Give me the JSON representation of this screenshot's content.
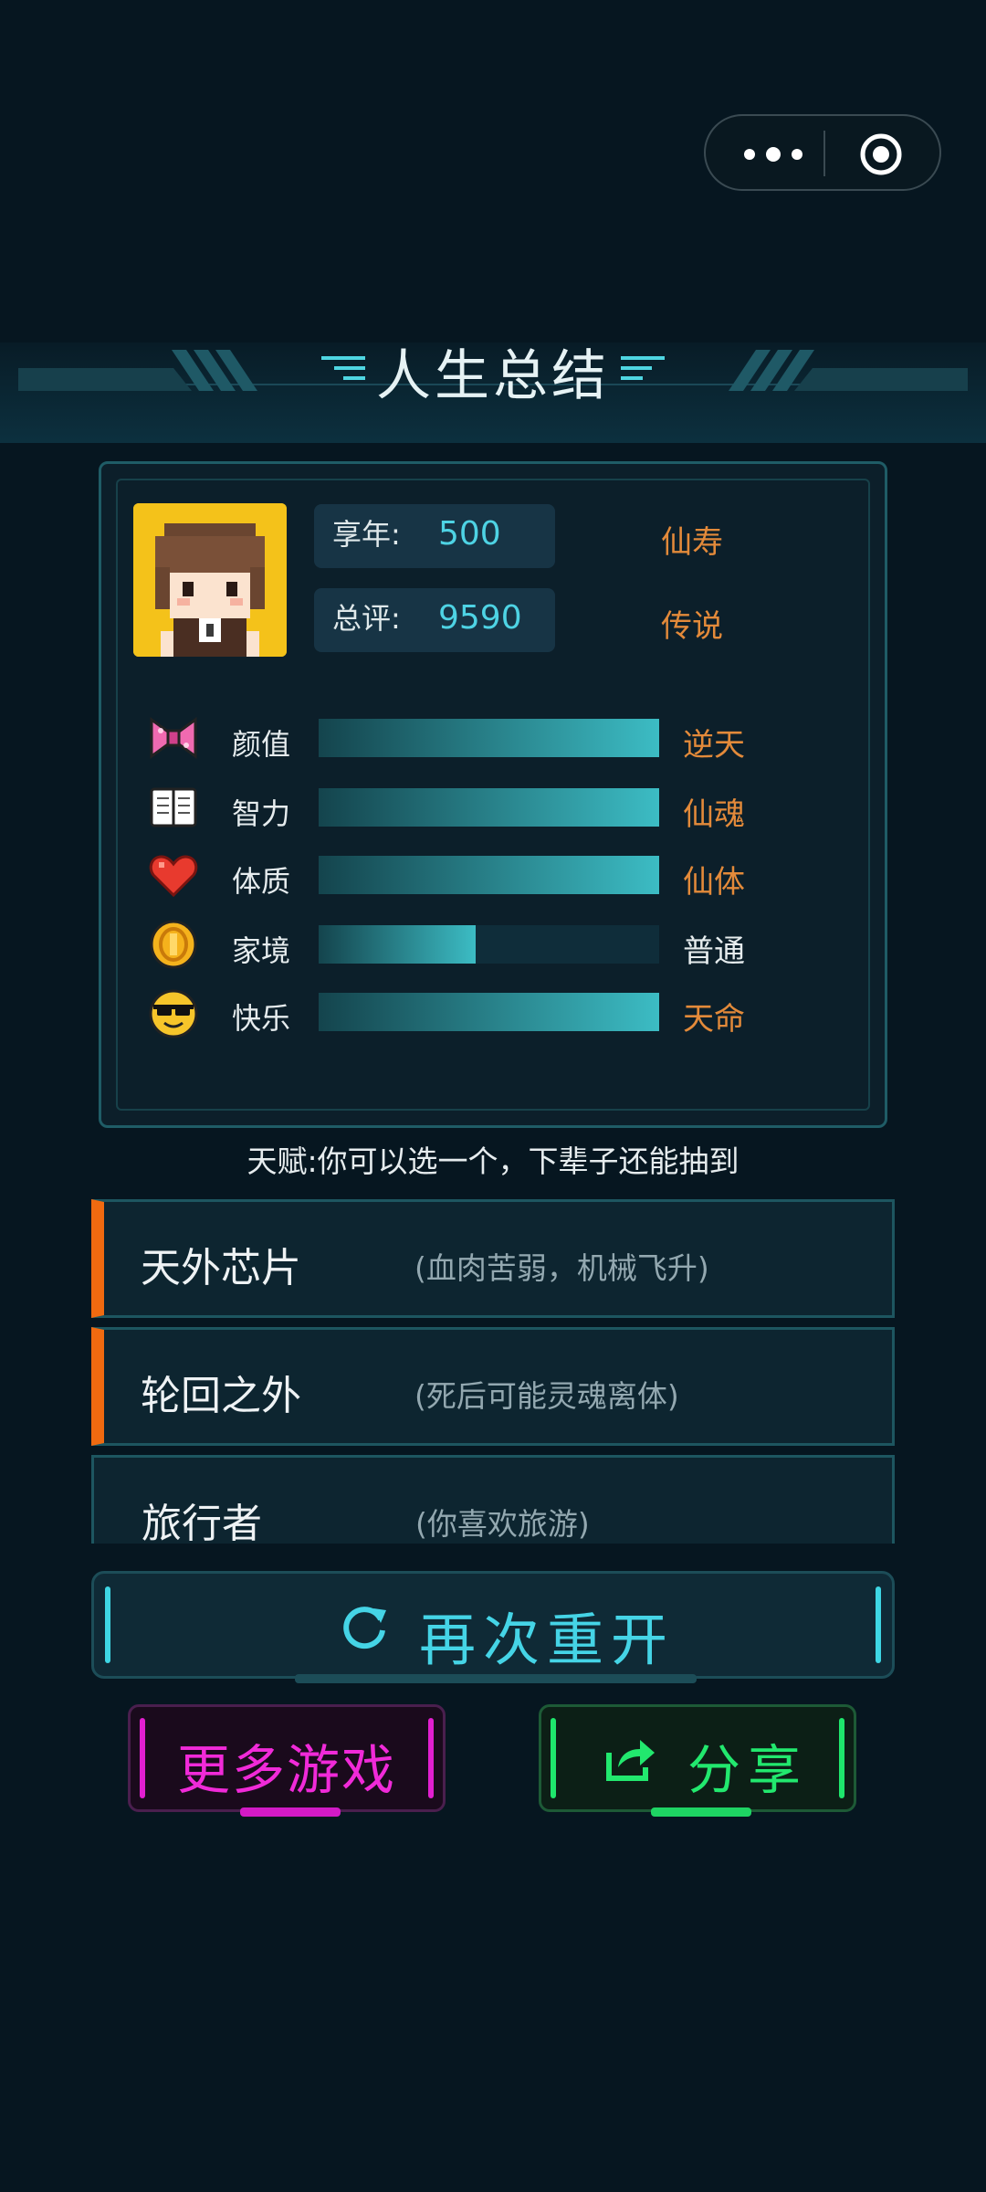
{
  "title": "人生总结",
  "summary": {
    "age_label": "享年:",
    "age_value": "500",
    "age_grade": "仙寿",
    "score_label": "总评:",
    "score_value": "9590",
    "score_grade": "传说"
  },
  "attributes": [
    {
      "label": "颜值",
      "icon": "bow-icon",
      "grade": "逆天",
      "fill": 1.0,
      "grade_color": "#e38a3a"
    },
    {
      "label": "智力",
      "icon": "book-icon",
      "grade": "仙魂",
      "fill": 1.0,
      "grade_color": "#e38a3a"
    },
    {
      "label": "体质",
      "icon": "heart-icon",
      "grade": "仙体",
      "fill": 1.0,
      "grade_color": "#e38a3a"
    },
    {
      "label": "家境",
      "icon": "coin-icon",
      "grade": "普通",
      "fill": 0.46,
      "grade_color": "#e6ecee"
    },
    {
      "label": "快乐",
      "icon": "sunglasses-face-icon",
      "grade": "天命",
      "fill": 1.0,
      "grade_color": "#e38a3a"
    }
  ],
  "talent_hint": "天赋:你可以选一个，下辈子还能抽到",
  "talents": [
    {
      "name": "天外芯片",
      "desc": "(血肉苦弱，机械飞升)",
      "selected": true
    },
    {
      "name": "轮回之外",
      "desc": "(死后可能灵魂离体)",
      "selected": true
    },
    {
      "name": "旅行者",
      "desc": "(你喜欢旅游)",
      "selected": false
    }
  ],
  "buttons": {
    "restart": "再次重开",
    "more_games": "更多游戏",
    "share": "分享"
  },
  "colors": {
    "accent_cyan": "#45d4e6",
    "grade_orange": "#e38a3a",
    "talent_marker": "#f06a10",
    "more_magenta": "#f02ad8",
    "share_green": "#22e86e"
  }
}
